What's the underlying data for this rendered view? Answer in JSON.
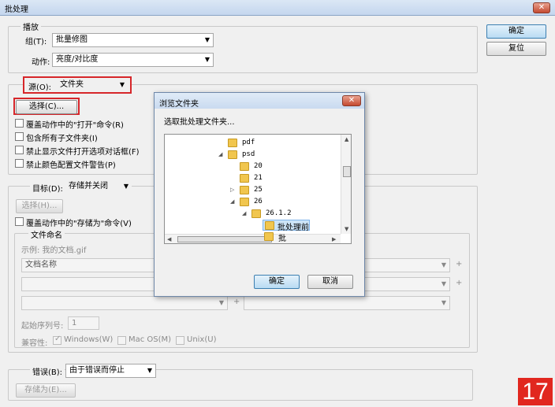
{
  "window": {
    "title": "批处理",
    "close": "✕"
  },
  "buttons": {
    "ok": "确定",
    "reset": "复位"
  },
  "play": {
    "legend": "播放",
    "set_label": "组(T):",
    "set_value": "批量修图",
    "action_label": "动作:",
    "action_value": "亮度/对比度"
  },
  "source": {
    "label": "源(O):",
    "value": "文件夹",
    "choose_button": "选择(C)...",
    "options": [
      "覆盖动作中的\"打开\"命令(R)",
      "包含所有子文件夹(I)",
      "禁止显示文件打开选项对话框(F)",
      "禁止颜色配置文件警告(P)"
    ]
  },
  "dest": {
    "label": "目标(D):",
    "value": "存储并关闭",
    "choose_button": "选择(H)...",
    "override": "覆盖动作中的\"存储为\"命令(V)"
  },
  "naming": {
    "legend": "文件命名",
    "example": "示例: 我的文档.gif",
    "field1": "文档名称",
    "plus": "+",
    "serial_label": "起始序列号:",
    "serial_value": "1",
    "compat_label": "兼容性:",
    "windows": "Windows(W)",
    "mac": "Mac OS(M)",
    "unix": "Unix(U)"
  },
  "errors": {
    "label": "错误(B):",
    "value": "由于错误而停止",
    "save_as": "存储为(E)..."
  },
  "browse": {
    "title": "浏览文件夹",
    "close": "✕",
    "prompt": "选取批处理文件夹...",
    "tree": [
      {
        "name": "pdf"
      },
      {
        "name": "psd"
      },
      {
        "name": "20"
      },
      {
        "name": "21"
      },
      {
        "name": "25"
      },
      {
        "name": "26"
      },
      {
        "name": "26.1.2"
      },
      {
        "name": "批处理前"
      },
      {
        "name": "批处理后"
      }
    ],
    "ok": "确定",
    "cancel": "取消"
  },
  "step_badge": "17"
}
